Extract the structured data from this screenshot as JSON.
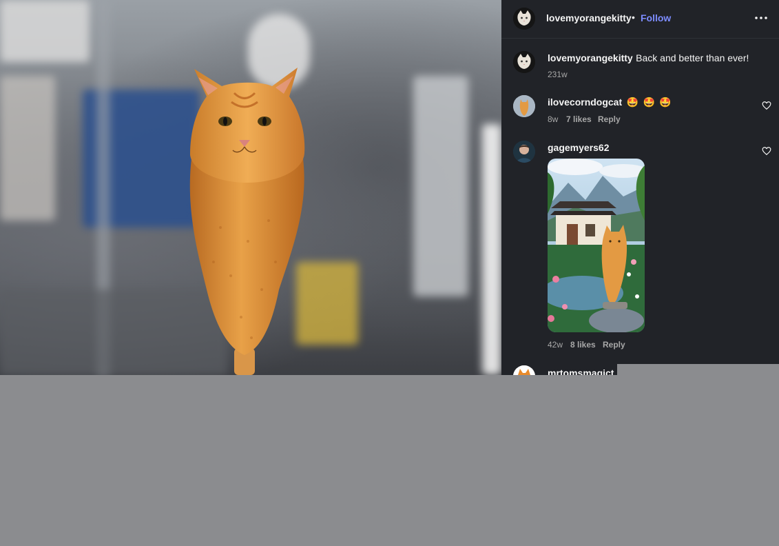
{
  "post": {
    "author": "lovemyorangekitty",
    "follow_label": "Follow",
    "separator": "•",
    "caption_user": "lovemyorangekitty",
    "caption_text": "Back and better than ever!",
    "caption_time": "231w"
  },
  "comments": [
    {
      "user": "ilovecorndogcat",
      "emoji": [
        "🤩",
        "🤩",
        "🤩"
      ],
      "time": "8w",
      "likes": "7 likes",
      "reply": "Reply"
    },
    {
      "user": "gagemyers62",
      "time": "42w",
      "likes": "8 likes",
      "reply": "Reply"
    },
    {
      "user": "mrtomsmagict"
    }
  ],
  "icons": {
    "more": "more-options-icon",
    "heart": "heart-icon"
  },
  "colors": {
    "panel_bg": "#212328",
    "follow": "#7d8cff",
    "meta": "#a8a8a8",
    "overlay_gray": "#8b8c8f"
  }
}
